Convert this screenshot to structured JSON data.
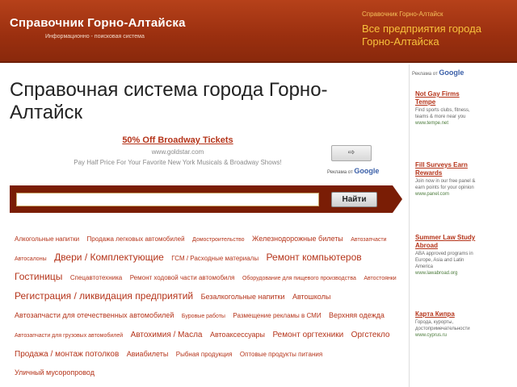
{
  "header": {
    "title": "Справочник Горно-Алтайска",
    "subtitle": "Информационно - поисковая система",
    "right_small": "Справочник Горно-Алтайск",
    "right_link": "Все предприятия города Горно-Алтайска"
  },
  "main": {
    "title": "Справочная система города Горно-Алтайск"
  },
  "ad": {
    "title": "50% Off Broadway Tickets",
    "url": "www.goldstar.com",
    "text": "Pay Half Price For Your Favorite New York Musicals & Broadway Shows!",
    "button_label": "⇨",
    "powered_prefix": "Реклама от",
    "powered_brand": "Google"
  },
  "search": {
    "value": "",
    "button_label": "Найти"
  },
  "tags": [
    {
      "label": "Алкогольные напитки",
      "size": 2
    },
    {
      "label": "Продажа легковых автомобилей",
      "size": 2
    },
    {
      "label": "Домостроительство",
      "size": 1
    },
    {
      "label": "Железнодорожные билеты",
      "size": 3
    },
    {
      "label": "Автозапчасти",
      "size": 1
    },
    {
      "label": "Автосалоны",
      "size": 1
    },
    {
      "label": "Двери / Комплектующие",
      "size": 5
    },
    {
      "label": "ГСМ / Расходные материалы",
      "size": 2
    },
    {
      "label": "Ремонт компьютеров",
      "size": 5
    },
    {
      "label": "Гостиницы",
      "size": 5
    },
    {
      "label": "Спецавтотехника",
      "size": 2
    },
    {
      "label": "Ремонт ходовой части автомобиля",
      "size": 2
    },
    {
      "label": "Оборудование для пищевого производства",
      "size": 1
    },
    {
      "label": "Автостоянки",
      "size": 1
    },
    {
      "label": "Регистрация / ликвидация предприятий",
      "size": 5
    },
    {
      "label": "Безалкогольные напитки",
      "size": 3
    },
    {
      "label": "Автошколы",
      "size": 3
    },
    {
      "label": "Автозапчасти для отечественных автомобилей",
      "size": 3
    },
    {
      "label": "Буровые работы",
      "size": 1
    },
    {
      "label": "Размещение рекламы в СМИ",
      "size": 2
    },
    {
      "label": "Верхняя одежда",
      "size": 3
    },
    {
      "label": "Автозапчасти для грузовых автомобилей",
      "size": 1
    },
    {
      "label": "Автохимия / Масла",
      "size": 4
    },
    {
      "label": "Автоаксессуары",
      "size": 3
    },
    {
      "label": "Ремонт оргтехники",
      "size": 4
    },
    {
      "label": "Оргстекло",
      "size": 4
    },
    {
      "label": "Продажа / монтаж потолков",
      "size": 4
    },
    {
      "label": "Авиабилеты",
      "size": 3
    },
    {
      "label": "Рыбная продукция",
      "size": 2
    },
    {
      "label": "Оптовые продукты питания",
      "size": 2
    },
    {
      "label": "Уличный мусоропровод",
      "size": 3
    }
  ],
  "sidebar": {
    "powered_prefix": "Реклама от",
    "powered_brand": "Google",
    "ads": [
      {
        "title": "Not Gay Firms Tempe",
        "text": "Find sports clubs, fitness, teams & more near you",
        "url": "www.tempe.net"
      },
      {
        "title": "Fill Surveys Earn Rewards",
        "text": "Join now in our free panel & earn points for your opinion",
        "url": "www.panel.com"
      },
      {
        "title": "Summer Law Study Abroad",
        "text": "ABA approved programs in Europe, Asia and Latin America",
        "url": "www.lawabroad.org"
      },
      {
        "title": "Карта Кипра",
        "text": "Города, курорты, достопримечательности",
        "url": "www.cyprus.ru"
      }
    ]
  }
}
